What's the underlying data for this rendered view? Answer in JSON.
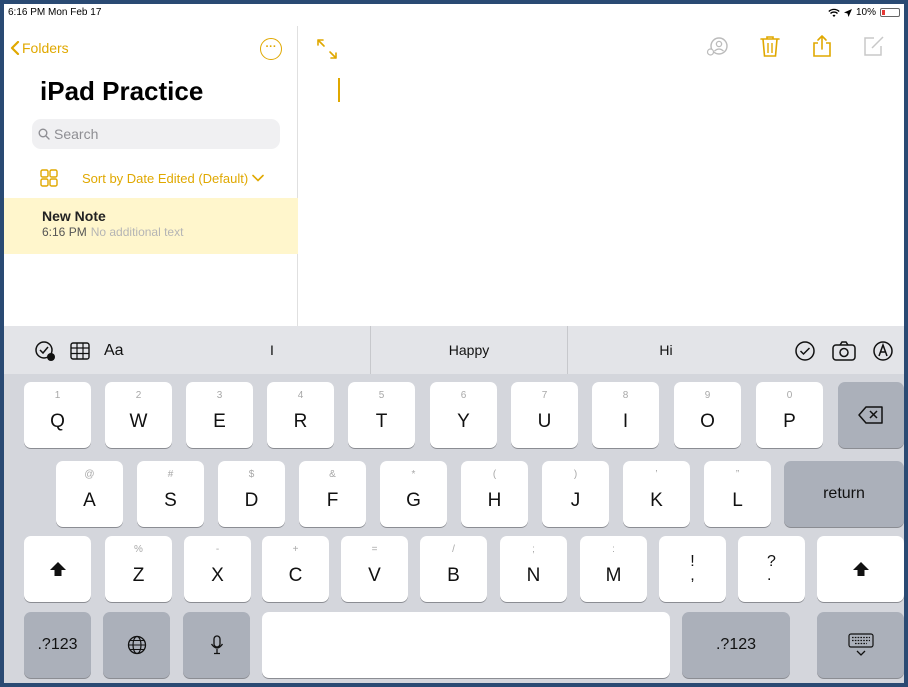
{
  "status_bar": {
    "time": "6:16 PM  Mon Feb 17",
    "battery": "10%"
  },
  "sidebar": {
    "back_label": "Folders",
    "title": "iPad Practice",
    "search_placeholder": "Search",
    "sort_label": "Sort by Date Edited (Default)",
    "notes": [
      {
        "title": "New Note",
        "time": "6:16 PM",
        "preview": "No additional text"
      }
    ]
  },
  "keyboard": {
    "format_label": "Aa",
    "suggestions": [
      "I",
      "Happy",
      "Hi"
    ],
    "row1": [
      {
        "hint": "1",
        "key": "Q"
      },
      {
        "hint": "2",
        "key": "W"
      },
      {
        "hint": "3",
        "key": "E"
      },
      {
        "hint": "4",
        "key": "R"
      },
      {
        "hint": "5",
        "key": "T"
      },
      {
        "hint": "6",
        "key": "Y"
      },
      {
        "hint": "7",
        "key": "U"
      },
      {
        "hint": "8",
        "key": "I"
      },
      {
        "hint": "9",
        "key": "O"
      },
      {
        "hint": "0",
        "key": "P"
      }
    ],
    "row2": [
      {
        "hint": "@",
        "key": "A"
      },
      {
        "hint": "#",
        "key": "S"
      },
      {
        "hint": "$",
        "key": "D"
      },
      {
        "hint": "&",
        "key": "F"
      },
      {
        "hint": "*",
        "key": "G"
      },
      {
        "hint": "(",
        "key": "H"
      },
      {
        "hint": ")",
        "key": "J"
      },
      {
        "hint": "’",
        "key": "K"
      },
      {
        "hint": "”",
        "key": "L"
      }
    ],
    "row3": [
      {
        "hint": "%",
        "key": "Z"
      },
      {
        "hint": "-",
        "key": "X"
      },
      {
        "hint": "+",
        "key": "C"
      },
      {
        "hint": "=",
        "key": "V"
      },
      {
        "hint": "/",
        "key": "B"
      },
      {
        "hint": ";",
        "key": "N"
      },
      {
        "hint": ":",
        "key": "M"
      }
    ],
    "punct1": {
      "top": "!",
      "bottom": ","
    },
    "punct2": {
      "top": "?",
      "bottom": "."
    },
    "return_label": "return",
    "numbers_label": ".?123"
  },
  "colors": {
    "accent": "#e0a800",
    "note_highlight": "#fff6cc",
    "keyboard_bg": "#d4d6dc"
  }
}
